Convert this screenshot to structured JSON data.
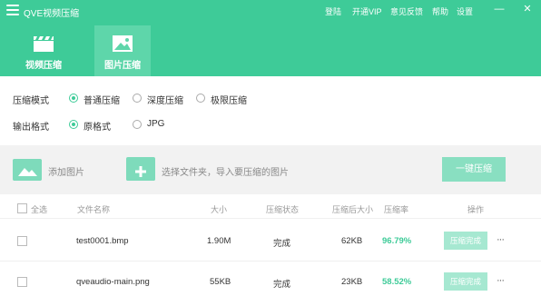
{
  "app": {
    "title": "QVE视频压缩"
  },
  "topnav": {
    "login": "登陆",
    "vip": "开通VIP",
    "feedback": "意见反馈",
    "help": "帮助",
    "settings": "设置"
  },
  "window": {
    "minimize_icon": "minimize-icon",
    "close_icon": "close-icon"
  },
  "tabs": [
    {
      "label": "视频压缩",
      "icon": "clapperboard-icon",
      "active": false
    },
    {
      "label": "图片压缩",
      "icon": "image-icon",
      "active": true
    }
  ],
  "options": {
    "mode": {
      "label": "压缩模式",
      "choices": [
        "普通压缩",
        "深度压缩",
        "极限压缩"
      ],
      "selected": "普通压缩"
    },
    "format": {
      "label": "输出格式",
      "choices": [
        "原格式",
        "JPG"
      ],
      "selected": "原格式"
    }
  },
  "toolbar": {
    "add_image": "添加图片",
    "select_folder": "选择文件夹，导入要压缩的图片",
    "compress_button": "一键压缩"
  },
  "table": {
    "headers": {
      "select_all": "全选",
      "filename": "文件名称",
      "size": "大小",
      "status": "压缩状态",
      "compressed_size": "压缩后大小",
      "ratio": "压缩率",
      "action": "操作"
    },
    "rows": [
      {
        "filename": "test0001.bmp",
        "size": "1.90M",
        "status": "完成",
        "compressed_size": "62KB",
        "ratio": "96.79%",
        "action": "压缩完成",
        "more": "···"
      },
      {
        "filename": "qveaudio-main.png",
        "size": "55KB",
        "status": "完成",
        "compressed_size": "23KB",
        "ratio": "58.52%",
        "action": "压缩完成",
        "more": "···"
      }
    ]
  },
  "colors": {
    "accent": "#3ecb98",
    "accent_light": "#5ed6aa",
    "button": "#89dfc1",
    "row_button": "#a6e8d1"
  }
}
